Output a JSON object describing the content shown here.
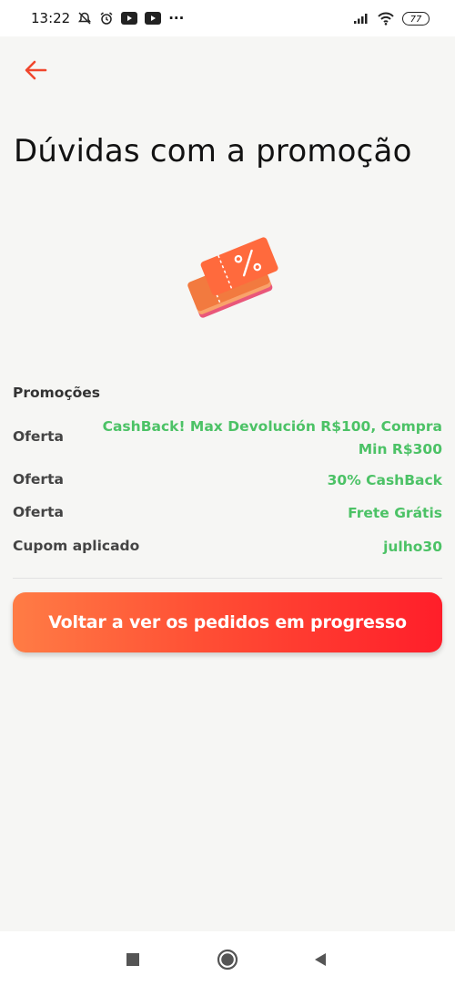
{
  "status_bar": {
    "time": "13:22",
    "more": "···",
    "battery": "77"
  },
  "header": {
    "title": "Dúvidas com a promoção"
  },
  "promotions": {
    "section_title": "Promoções",
    "rows": [
      {
        "label": "Oferta",
        "value": "CashBack! Max Devolución R$100, Compra Min R$300"
      },
      {
        "label": "Oferta",
        "value": "30% CashBack"
      },
      {
        "label": "Oferta",
        "value": "Frete Grátis"
      },
      {
        "label": "Cupom aplicado",
        "value": "julho30"
      }
    ]
  },
  "actions": {
    "back_to_orders": "Voltar a ver os pedidos em progresso"
  },
  "icons": {
    "back": "arrow-left-icon",
    "hero": "discount-ticket-icon",
    "nav_recents": "square-icon",
    "nav_home": "circle-icon",
    "nav_back": "triangle-back-icon"
  },
  "colors": {
    "accent": "#ff4e34",
    "success_text": "#4cc266",
    "background": "#f6f6f4"
  }
}
